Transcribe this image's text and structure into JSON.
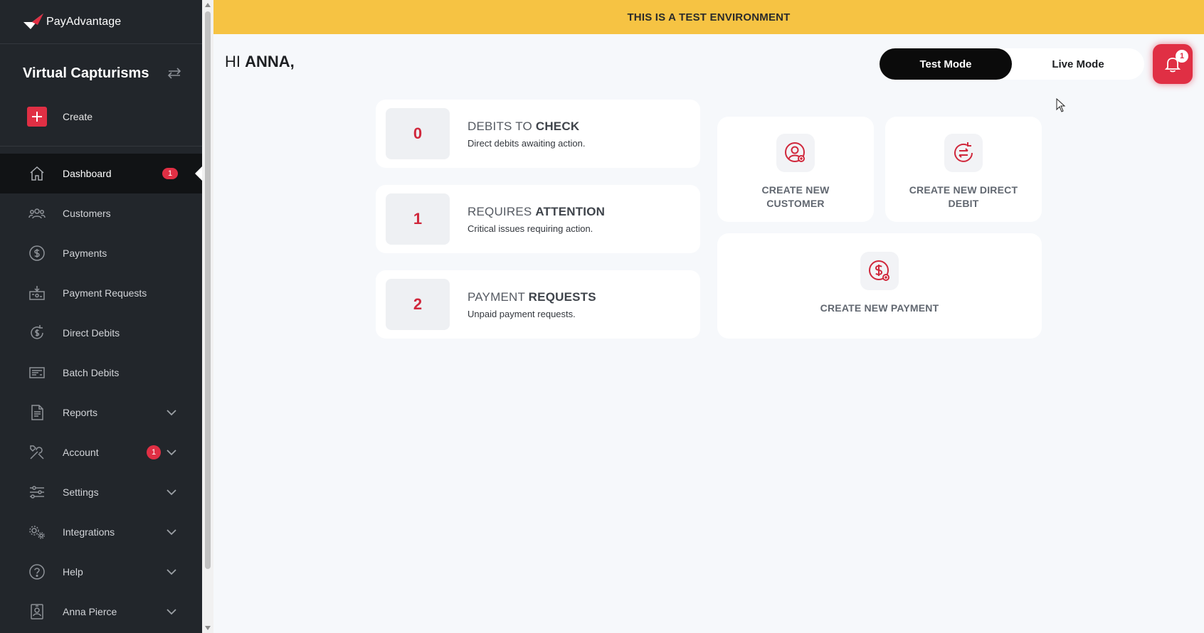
{
  "brand": {
    "name": "PayAdvantage"
  },
  "org": {
    "name": "Virtual Capturisms"
  },
  "sidebar": {
    "create_label": "Create",
    "items": [
      {
        "label": "Dashboard",
        "icon": "home-icon",
        "badge": "1"
      },
      {
        "label": "Customers",
        "icon": "users-icon"
      },
      {
        "label": "Payments",
        "icon": "dollar-circle-icon"
      },
      {
        "label": "Payment Requests",
        "icon": "payment-request-icon"
      },
      {
        "label": "Direct Debits",
        "icon": "direct-debit-icon"
      },
      {
        "label": "Batch Debits",
        "icon": "batch-icon"
      },
      {
        "label": "Reports",
        "icon": "document-icon"
      },
      {
        "label": "Account",
        "icon": "tools-icon",
        "badge": "1"
      },
      {
        "label": "Settings",
        "icon": "sliders-icon"
      },
      {
        "label": "Integrations",
        "icon": "gears-icon"
      },
      {
        "label": "Help",
        "icon": "help-icon"
      },
      {
        "label": "Anna Pierce",
        "icon": "user-card-icon"
      }
    ]
  },
  "banner": {
    "text": "THIS IS A TEST ENVIRONMENT"
  },
  "header": {
    "greeting_prefix": "HI ",
    "greeting_name": "ANNA,",
    "mode_test": "Test Mode",
    "mode_live": "Live Mode",
    "notification_count": "1"
  },
  "stats": [
    {
      "count": "0",
      "title_a": "DEBITS TO ",
      "title_b": "CHECK",
      "desc": "Direct debits awaiting action."
    },
    {
      "count": "1",
      "title_a": "REQUIRES ",
      "title_b": "ATTENTION",
      "desc": "Critical issues requiring action."
    },
    {
      "count": "2",
      "title_a": "PAYMENT ",
      "title_b": "REQUESTS",
      "desc": "Unpaid payment requests."
    }
  ],
  "actions": {
    "customer_line1": "CREATE NEW",
    "customer_line2": "CUSTOMER",
    "debit_line1": "CREATE NEW DIRECT",
    "debit_line2": "DEBIT",
    "payment": "CREATE NEW PAYMENT"
  },
  "colors": {
    "accent": "#e02f44",
    "banner": "#f6c343",
    "sidebar": "#22262b"
  }
}
